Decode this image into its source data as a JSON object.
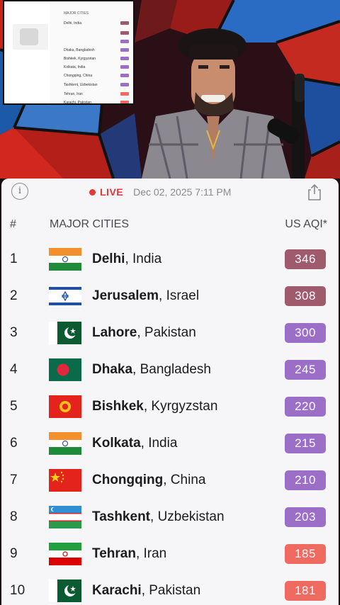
{
  "colors": {
    "hazardous": "#a05a6e",
    "very_unhealthy": "#9b6fc7",
    "unhealthy": "#ef6a61",
    "live": "#e2383c"
  },
  "topbar": {
    "info_icon": "info-icon",
    "live_label": "LIVE",
    "timestamp": "Dec 02, 2025 7:11 PM",
    "share_icon": "share-icon"
  },
  "table": {
    "col_rank": "#",
    "col_city": "MAJOR CITIES",
    "col_aqi": "US AQI*",
    "rows": [
      {
        "rank": "1",
        "city": "Delhi",
        "country": ", India",
        "aqi": "346",
        "flag": "india",
        "level": "hazardous"
      },
      {
        "rank": "2",
        "city": "Jerusalem",
        "country": ", Israel",
        "aqi": "308",
        "flag": "israel",
        "level": "hazardous"
      },
      {
        "rank": "3",
        "city": "Lahore",
        "country": ", Pakistan",
        "aqi": "300",
        "flag": "pakistan",
        "level": "very_unhealthy"
      },
      {
        "rank": "4",
        "city": "Dhaka",
        "country": ", Bangladesh",
        "aqi": "245",
        "flag": "bangladesh",
        "level": "very_unhealthy"
      },
      {
        "rank": "5",
        "city": "Bishkek",
        "country": ", Kyrgyzstan",
        "aqi": "220",
        "flag": "kyrgyzstan",
        "level": "very_unhealthy"
      },
      {
        "rank": "6",
        "city": "Kolkata",
        "country": ", India",
        "aqi": "215",
        "flag": "india",
        "level": "very_unhealthy"
      },
      {
        "rank": "7",
        "city": "Chongqing",
        "country": ", China",
        "aqi": "210",
        "flag": "china",
        "level": "very_unhealthy"
      },
      {
        "rank": "8",
        "city": "Tashkent",
        "country": ", Uzbekistan",
        "aqi": "203",
        "flag": "uzbekistan",
        "level": "very_unhealthy"
      },
      {
        "rank": "9",
        "city": "Tehran",
        "country": ", Iran",
        "aqi": "185",
        "flag": "iran",
        "level": "unhealthy"
      },
      {
        "rank": "10",
        "city": "Karachi",
        "country": ", Pakistan",
        "aqi": "181",
        "flag": "pakistan",
        "level": "unhealthy"
      }
    ]
  },
  "pip": {
    "header": "MAJOR CITIES",
    "rows": [
      "Delhi, India",
      "Dhaka, Bangladesh",
      "Bishkek, Kyrgyzstan",
      "Kolkata, India",
      "Chongqing, China",
      "Tashkent, Uzbekistan",
      "Tehran, Iran",
      "Karachi, Pakistan"
    ]
  }
}
